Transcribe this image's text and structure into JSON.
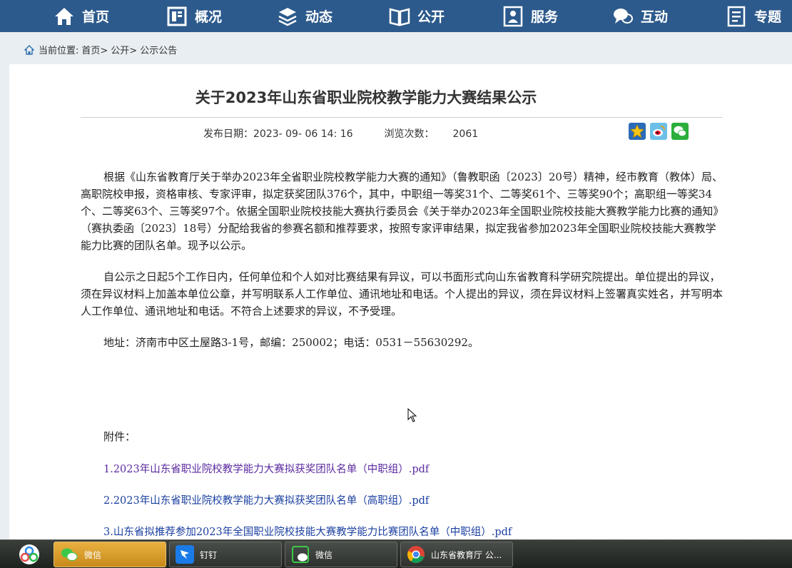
{
  "nav": {
    "items": [
      {
        "label": "首页",
        "icon": "home-icon"
      },
      {
        "label": "概况",
        "icon": "overview-icon"
      },
      {
        "label": "动态",
        "icon": "layers-icon"
      },
      {
        "label": "公开",
        "icon": "book-icon"
      },
      {
        "label": "服务",
        "icon": "service-icon"
      },
      {
        "label": "互动",
        "icon": "chat-icon"
      },
      {
        "label": "专题",
        "icon": "document-icon"
      }
    ],
    "bg_color": "#2d5a8c"
  },
  "breadcrumb": {
    "prefix": "当前位置:",
    "items": [
      "首页>",
      "公开>",
      "公示公告"
    ]
  },
  "article": {
    "title": "关于2023年山东省职业院校教学能力大赛结果公示",
    "publish_label": "发布日期：",
    "publish_date": "2023- 09- 06 14: 16",
    "views_label": "浏览次数：",
    "views": "2061",
    "paragraphs": [
      "根据《山东省教育厅关于举办2023年全省职业院校教学能力大赛的通知》（鲁教职函〔2023〕20号）精神，经市教育（教体）局、高职院校申报，资格审核、专家评审，拟定获奖团队376个，其中，中职组一等奖31个、二等奖61个、三等奖90个；高职组一等奖34个、二等奖63个、三等奖97个。依据全国职业院校技能大赛执行委员会《关于举办2023年全国职业院校技能大赛教学能力比赛的通知》（赛执委函〔2023〕18号）分配给我省的参赛名额和推荐要求，按照专家评审结果，拟定我省参加2023年全国职业院校技能大赛教学能力比赛的团队名单。现予以公示。",
      "自公示之日起5个工作日内，任何单位和个人如对比赛结果有异议，可以书面形式向山东省教育科学研究院提出。单位提出的异议，须在异议材料上加盖本单位公章，并写明联系人工作单位、通讯地址和电话。个人提出的异议，须在异议材料上签署真实姓名，并写明本人工作单位、通讯地址和电话。不符合上述要求的异议，不予受理。",
      "地址：济南市中区土屋路3-1号，邮编：250002；电话：0531－55630292。"
    ],
    "attachments_label": "附件：",
    "attachments": [
      "1.2023年山东省职业院校教学能力大赛拟获奖团队名单（中职组）.pdf",
      "2.2023年山东省职业院校教学能力大赛拟获奖团队名单（高职组）.pdf",
      "3.山东省拟推荐参加2023年全国职业院校技能大赛教学能力比赛团队名单（中职组）.pdf"
    ]
  },
  "share": [
    "favorite-icon",
    "weibo-icon",
    "wechat-icon"
  ],
  "taskbar": {
    "tasks": [
      {
        "label": "微信",
        "icon": "wechat-icon"
      },
      {
        "label": "钉钉",
        "icon": "dingtalk-icon"
      },
      {
        "label": "微信",
        "icon": "wechat-icon"
      },
      {
        "label": "山东省教育厅 公...",
        "icon": "chrome-icon"
      }
    ]
  }
}
